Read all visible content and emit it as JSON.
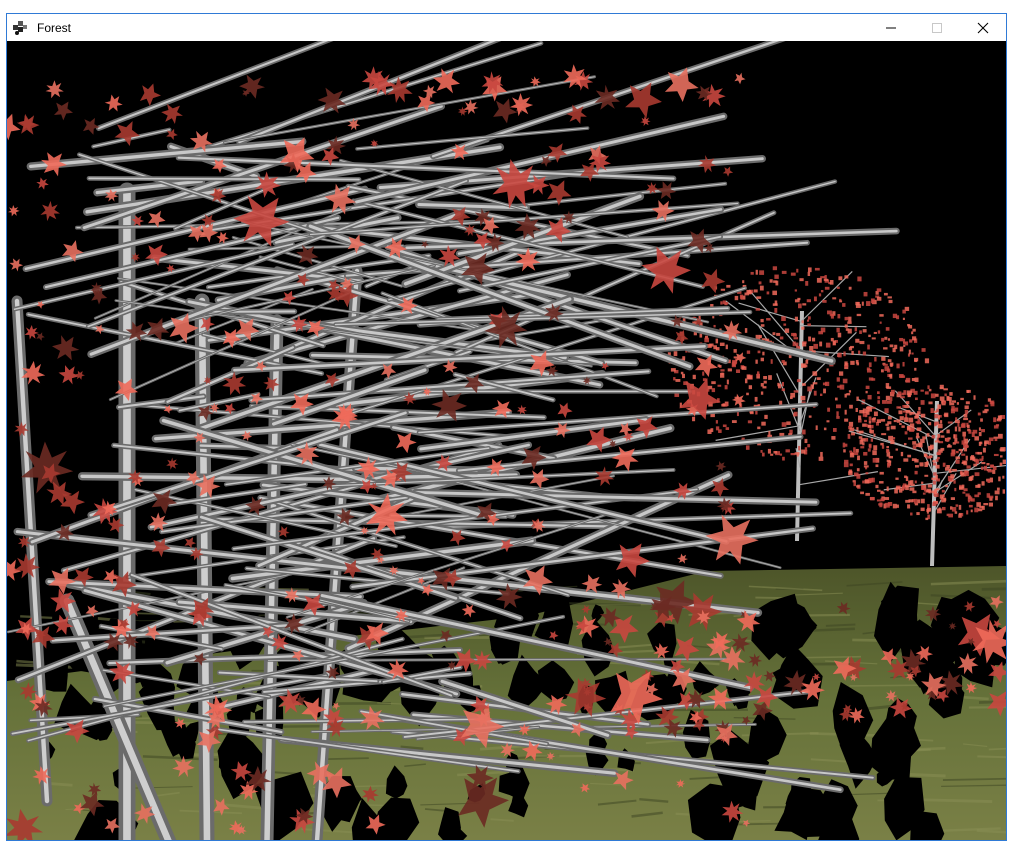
{
  "window": {
    "title": "Forest",
    "app_icon": "opengl-app-icon",
    "controls": [
      {
        "name": "minimize-button",
        "icon": "minimize-icon"
      },
      {
        "name": "maximize-button",
        "icon": "maximize-icon",
        "disabled": true
      },
      {
        "name": "close-button",
        "icon": "close-icon"
      }
    ]
  },
  "scene": {
    "description_icon": "3d-forest-render",
    "colors": {
      "sky": "#000000",
      "ground": "#5f6b35",
      "ground_dark": "#3d4523",
      "bark_light": "#d9d9d9",
      "bark_dark": "#6b6b6b",
      "leaf_light": "#f06a5a",
      "leaf_mid": "#c9473f",
      "leaf_dark": "#6b2a22",
      "shadow": "#000000",
      "window_border": "#2f7ad6"
    }
  }
}
